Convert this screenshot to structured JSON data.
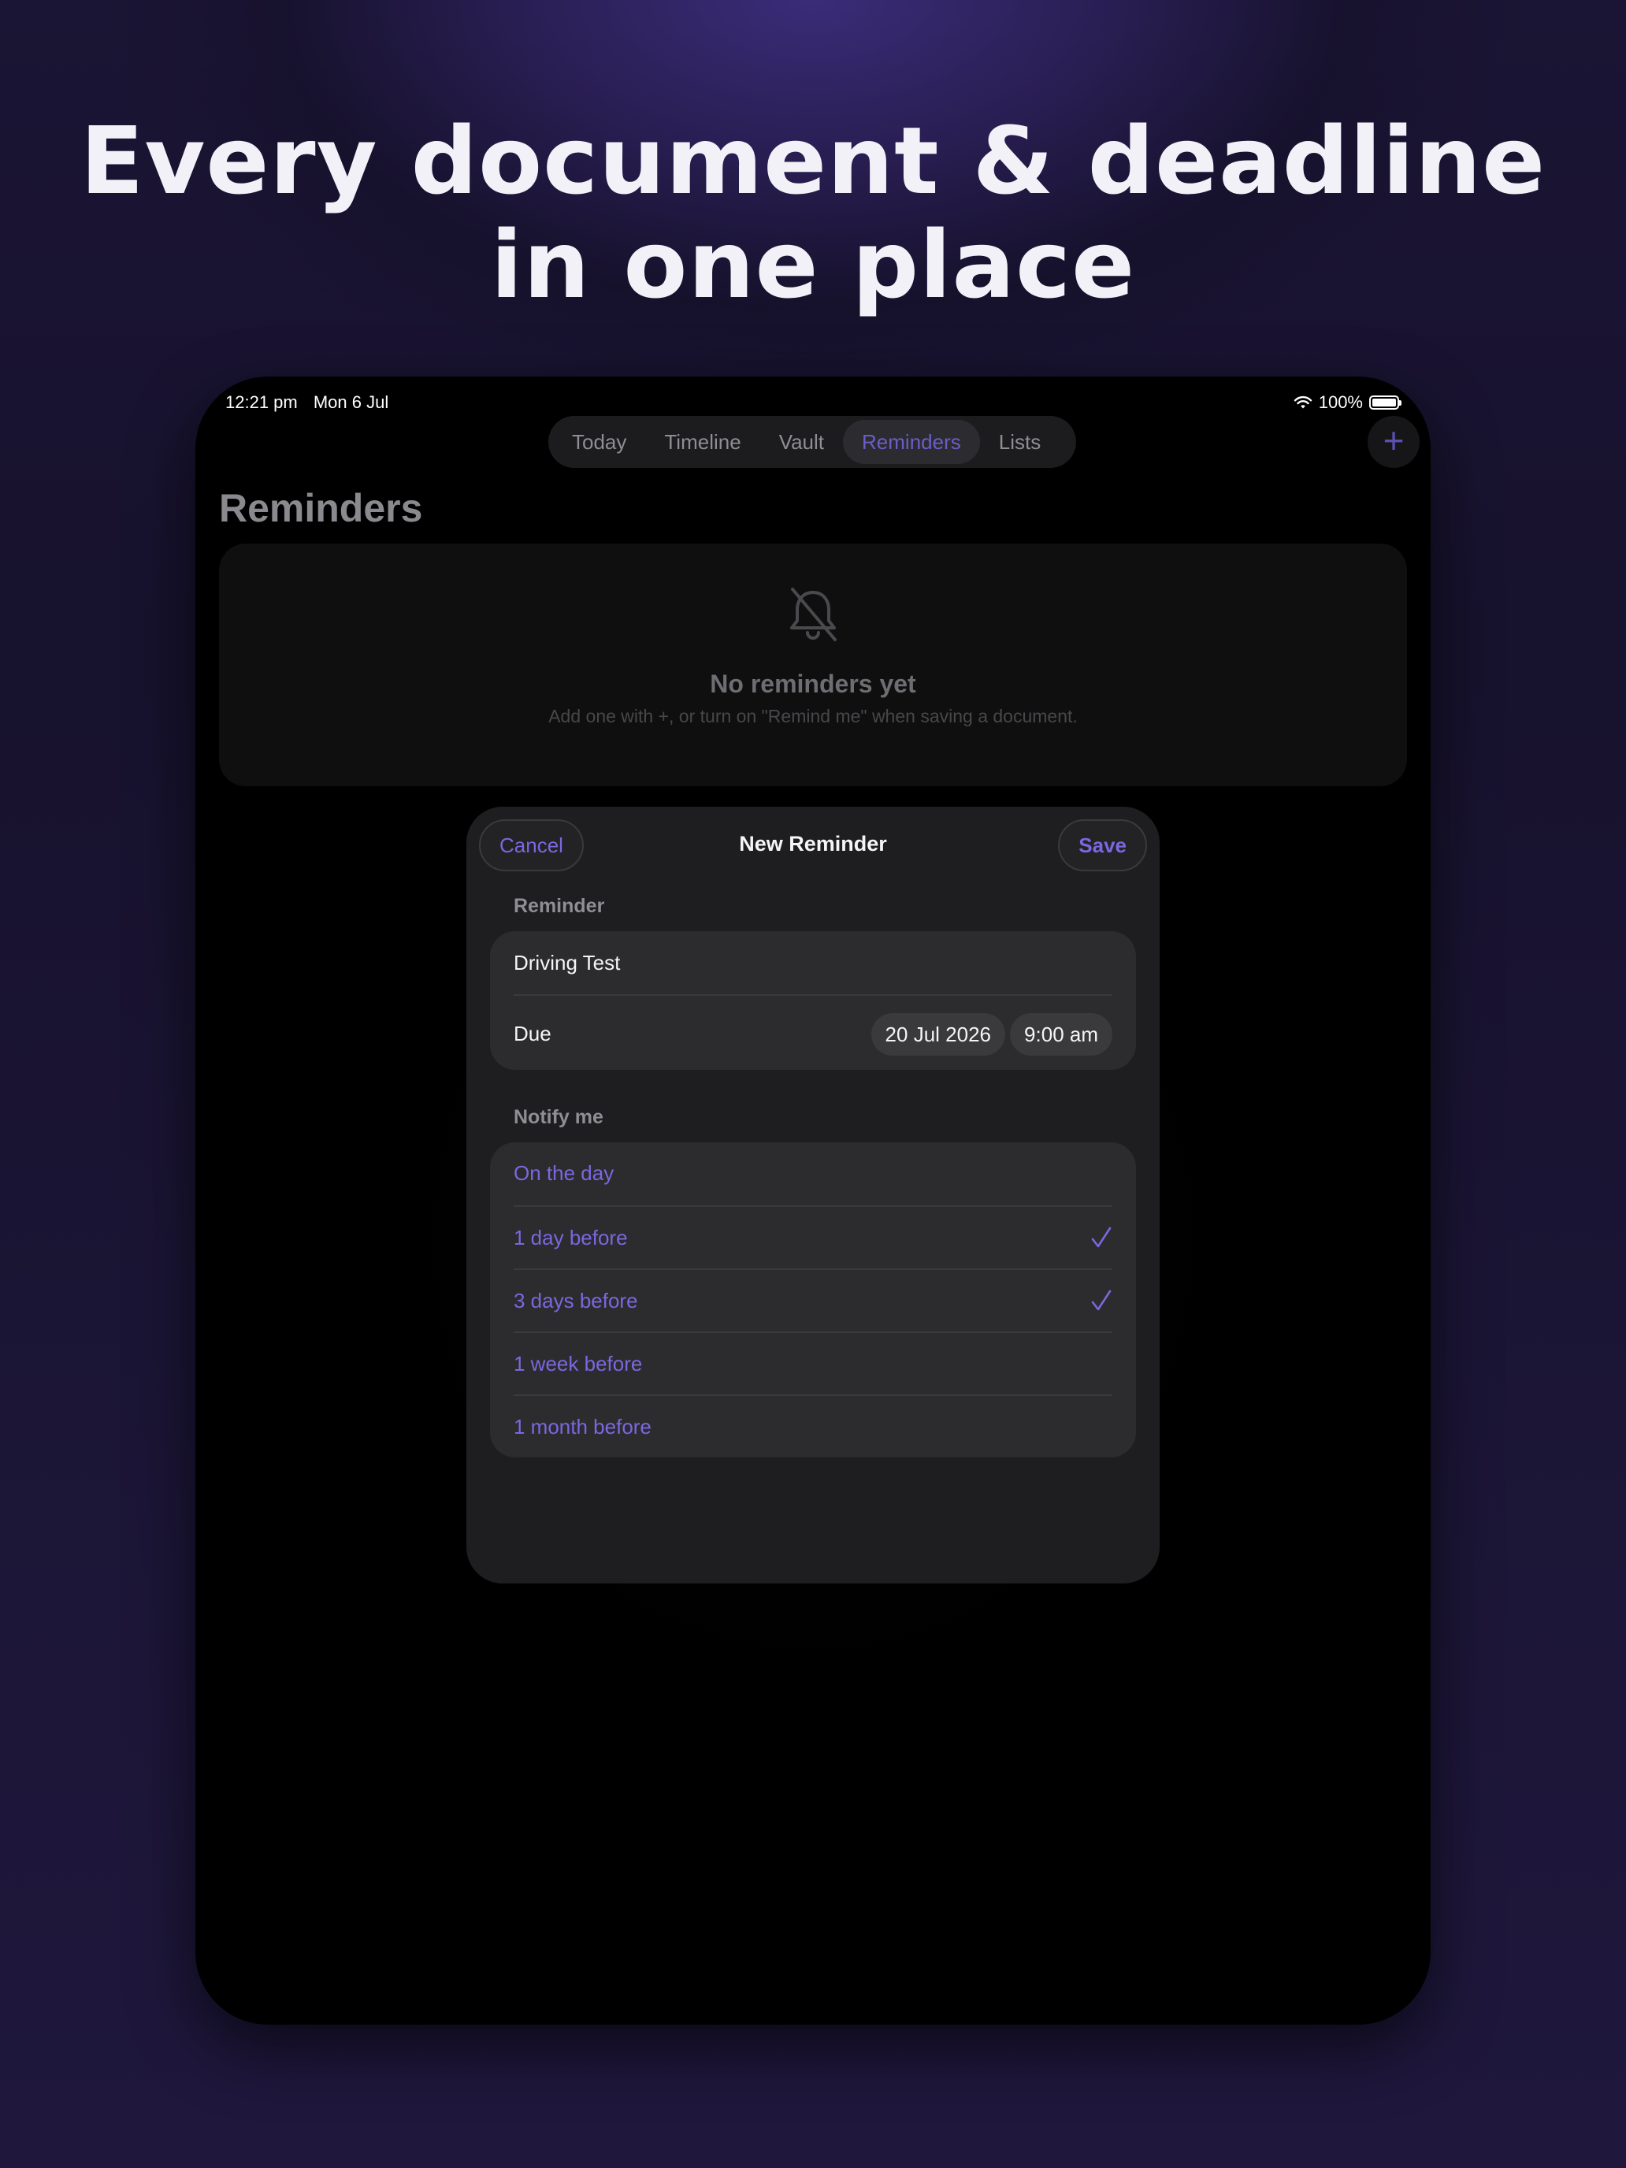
{
  "headline": {
    "line1": "Every document & deadline",
    "line2": "in one place"
  },
  "status_bar": {
    "time": "12:21 pm",
    "date": "Mon 6 Jul",
    "battery": "100%"
  },
  "tabs": [
    {
      "label": "Today",
      "active": false
    },
    {
      "label": "Timeline",
      "active": false
    },
    {
      "label": "Vault",
      "active": false
    },
    {
      "label": "Reminders",
      "active": true
    },
    {
      "label": "Lists",
      "active": false
    }
  ],
  "add_button": {
    "icon": "plus-icon",
    "label": "+"
  },
  "page": {
    "title": "Reminders",
    "empty_state": {
      "icon": "bell-slash-icon",
      "title": "No reminders yet",
      "subtitle": "Add one with +, or turn on \"Remind me\" when saving a document."
    }
  },
  "sheet": {
    "title": "New Reminder",
    "cancel_label": "Cancel",
    "save_label": "Save",
    "reminder_section_label": "Reminder",
    "reminder_name": "Driving Test",
    "due_label": "Due",
    "due_date": "20 Jul 2026",
    "due_time": "9:00 am",
    "notify_section_label": "Notify me",
    "notify_options": [
      {
        "label": "On the day",
        "checked": false
      },
      {
        "label": "1 day before",
        "checked": true
      },
      {
        "label": "3 days before",
        "checked": true
      },
      {
        "label": "1 week before",
        "checked": false
      },
      {
        "label": "1 month before",
        "checked": false
      }
    ]
  },
  "colors": {
    "accent": "#7b67e0",
    "background": "#1e1838",
    "card": "#2c2c2e"
  }
}
